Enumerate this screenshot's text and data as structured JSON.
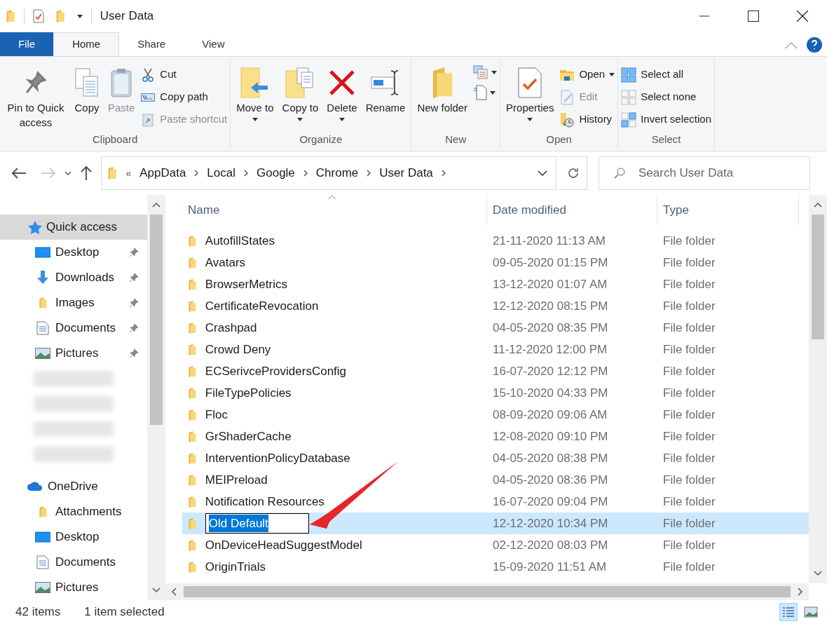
{
  "window": {
    "title": "User Data"
  },
  "ribbon_tabs": [
    {
      "label": "File",
      "kind": "file",
      "selected": false
    },
    {
      "label": "Home",
      "kind": "tab",
      "selected": true
    },
    {
      "label": "Share",
      "kind": "tab",
      "selected": false
    },
    {
      "label": "View",
      "kind": "tab",
      "selected": false
    }
  ],
  "ribbon": {
    "groups": [
      {
        "label": "Clipboard",
        "items": [
          {
            "kind": "large",
            "label": "Pin to Quick access",
            "disabled": false,
            "dropdown": false
          },
          {
            "kind": "large",
            "label": "Copy",
            "disabled": false,
            "dropdown": false
          },
          {
            "kind": "large",
            "label": "Paste",
            "disabled": true,
            "dropdown": false
          },
          {
            "kind": "small",
            "label": "Cut",
            "disabled": false,
            "dropdown": false
          },
          {
            "kind": "small",
            "label": "Copy path",
            "disabled": false,
            "dropdown": false
          },
          {
            "kind": "small",
            "label": "Paste shortcut",
            "disabled": true,
            "dropdown": false
          }
        ]
      },
      {
        "label": "Organize",
        "items": [
          {
            "kind": "large",
            "label": "Move to",
            "disabled": false,
            "dropdown": true
          },
          {
            "kind": "large",
            "label": "Copy to",
            "disabled": false,
            "dropdown": true
          },
          {
            "kind": "large",
            "label": "Delete",
            "disabled": false,
            "dropdown": true
          },
          {
            "kind": "large",
            "label": "Rename",
            "disabled": false,
            "dropdown": false
          }
        ]
      },
      {
        "label": "New",
        "items": [
          {
            "kind": "large",
            "label": "New folder",
            "disabled": false,
            "dropdown": false
          },
          {
            "kind": "icon",
            "disabled": false,
            "dropdown": true
          },
          {
            "kind": "icon",
            "disabled": false,
            "dropdown": true
          }
        ]
      },
      {
        "label": "Open",
        "items": [
          {
            "kind": "large",
            "label": "Properties",
            "disabled": false,
            "dropdown": true
          },
          {
            "kind": "small",
            "label": "Open",
            "disabled": false,
            "dropdown": true
          },
          {
            "kind": "small",
            "label": "Edit",
            "disabled": true,
            "dropdown": false
          },
          {
            "kind": "small",
            "label": "History",
            "disabled": false,
            "dropdown": false
          }
        ]
      },
      {
        "label": "Select",
        "items": [
          {
            "kind": "small",
            "label": "Select all",
            "disabled": false,
            "dropdown": false
          },
          {
            "kind": "small",
            "label": "Select none",
            "disabled": false,
            "dropdown": false
          },
          {
            "kind": "small",
            "label": "Invert selection",
            "disabled": false,
            "dropdown": false
          }
        ]
      }
    ]
  },
  "address_bar": {
    "overflow": "«",
    "path": [
      "AppData",
      "Local",
      "Google",
      "Chrome",
      "User Data"
    ]
  },
  "search": {
    "placeholder": "Search User Data"
  },
  "sidebar": {
    "sections": [
      {
        "label": "Quick access",
        "selected": true,
        "children": [
          {
            "label": "Desktop",
            "pinned": true
          },
          {
            "label": "Downloads",
            "pinned": true
          },
          {
            "label": "Images",
            "pinned": true
          },
          {
            "label": "Documents",
            "pinned": true
          },
          {
            "label": "Pictures",
            "pinned": true
          }
        ]
      },
      {
        "label": "OneDrive",
        "selected": false,
        "children": [
          {
            "label": "Attachments",
            "pinned": false
          },
          {
            "label": "Desktop",
            "pinned": false
          },
          {
            "label": "Documents",
            "pinned": false
          },
          {
            "label": "Pictures",
            "pinned": false
          }
        ]
      }
    ]
  },
  "table": {
    "columns": [
      "Name",
      "Date modified",
      "Type"
    ],
    "rows": [
      {
        "name": "AutofillStates",
        "date": "21-11-2020 11:13 AM",
        "type": "File folder",
        "selected": false,
        "editing": false
      },
      {
        "name": "Avatars",
        "date": "09-05-2020 01:15 PM",
        "type": "File folder",
        "selected": false,
        "editing": false
      },
      {
        "name": "BrowserMetrics",
        "date": "13-12-2020 01:07 AM",
        "type": "File folder",
        "selected": false,
        "editing": false
      },
      {
        "name": "CertificateRevocation",
        "date": "12-12-2020 08:15 PM",
        "type": "File folder",
        "selected": false,
        "editing": false
      },
      {
        "name": "Crashpad",
        "date": "04-05-2020 08:35 PM",
        "type": "File folder",
        "selected": false,
        "editing": false
      },
      {
        "name": "Crowd Deny",
        "date": "11-12-2020 12:00 PM",
        "type": "File folder",
        "selected": false,
        "editing": false
      },
      {
        "name": "ECSerivceProvidersConfig",
        "date": "16-07-2020 12:12 PM",
        "type": "File folder",
        "selected": false,
        "editing": false
      },
      {
        "name": "FileTypePolicies",
        "date": "15-10-2020 04:33 PM",
        "type": "File folder",
        "selected": false,
        "editing": false
      },
      {
        "name": "Floc",
        "date": "08-09-2020 09:06 AM",
        "type": "File folder",
        "selected": false,
        "editing": false
      },
      {
        "name": "GrShaderCache",
        "date": "12-08-2020 09:10 PM",
        "type": "File folder",
        "selected": false,
        "editing": false
      },
      {
        "name": "InterventionPolicyDatabase",
        "date": "04-05-2020 08:38 PM",
        "type": "File folder",
        "selected": false,
        "editing": false
      },
      {
        "name": "MEIPreload",
        "date": "04-05-2020 08:36 PM",
        "type": "File folder",
        "selected": false,
        "editing": false
      },
      {
        "name": "Notification Resources",
        "date": "16-07-2020 09:04 PM",
        "type": "File folder",
        "selected": false,
        "editing": false
      },
      {
        "name": "Old Default",
        "date": "12-12-2020 10:34 PM",
        "type": "File folder",
        "selected": true,
        "editing": true
      },
      {
        "name": "OnDeviceHeadSuggestModel",
        "date": "02-12-2020 08:03 PM",
        "type": "File folder",
        "selected": false,
        "editing": false
      },
      {
        "name": "OriginTrials",
        "date": "15-09-2020 11:51 AM",
        "type": "File folder",
        "selected": false,
        "editing": false
      }
    ]
  },
  "status_bar": {
    "item_count": "42 items",
    "selection": "1 item selected",
    "views": [
      {
        "kind": "details",
        "selected": true
      },
      {
        "kind": "tiles",
        "selected": false
      }
    ]
  }
}
